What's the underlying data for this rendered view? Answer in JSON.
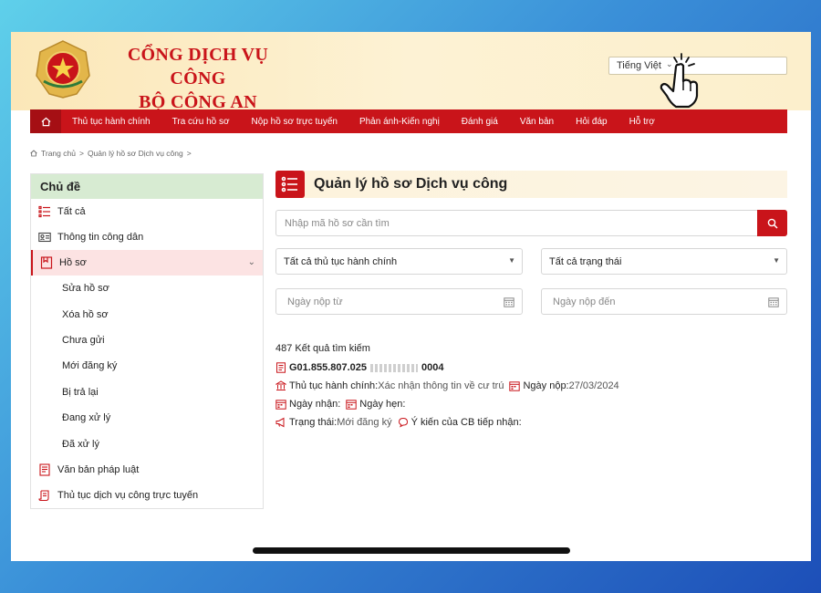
{
  "header": {
    "title_line1": "CỔNG DỊCH VỤ CÔNG",
    "title_line2": "BỘ CÔNG AN",
    "language": "Tiếng Việt"
  },
  "nav": {
    "items": [
      "Thủ tục hành chính",
      "Tra cứu hồ sơ",
      "Nộp hồ sơ trực tuyến",
      "Phản ánh-Kiến nghị",
      "Đánh giá",
      "Văn bản",
      "Hỏi đáp",
      "Hỗ trợ"
    ]
  },
  "breadcrumb": {
    "home": "Trang chủ",
    "current": "Quản lý hồ sơ Dịch vụ công",
    "sep": ">"
  },
  "sidebar": {
    "heading": "Chủ đề",
    "items": [
      {
        "label": "Tất cả",
        "icon": "list-icon"
      },
      {
        "label": "Thông tin công dân",
        "icon": "id-card-icon"
      },
      {
        "label": "Hồ sơ",
        "icon": "folder-icon"
      }
    ],
    "sub_items": [
      "Sửa hồ sơ",
      "Xóa hồ sơ",
      "Chưa gửi",
      "Mới đăng ký",
      "Bị trả lại",
      "Đang xử lý",
      "Đã xử lý"
    ],
    "bottom_items": [
      {
        "label": "Văn bản pháp luật",
        "icon": "document-icon"
      },
      {
        "label": "Thủ tục dịch vụ công trực tuyến",
        "icon": "scroll-icon"
      }
    ]
  },
  "main": {
    "title": "Quản lý hồ sơ Dịch vụ công",
    "search_placeholder": "Nhập mã hồ sơ cần tìm",
    "procedure_select": "Tất cả thủ tục hành chính",
    "status_select": "Tất cả trạng thái",
    "date_from_placeholder": "Ngày nộp từ",
    "date_to_placeholder": "Ngày nộp đến",
    "result_count": "487 Kết quả tìm kiếm"
  },
  "record": {
    "code_prefix": "G01.855.807.025",
    "code_suffix": "0004",
    "procedure_label": "Thủ tục hành chính:",
    "procedure_value": "Xác nhận thông tin về cư trú",
    "submit_label": "Ngày nộp:",
    "submit_value": "27/03/2024",
    "received_label": "Ngày nhận:",
    "appointment_label": "Ngày hẹn:",
    "status_label": "Trạng thái:",
    "status_value": "Mới đăng ký",
    "opinion_label": "Ý kiến của CB tiếp nhận:"
  },
  "colors": {
    "brand_red": "#c9141a",
    "header_gold": "#fbe7b8",
    "sidebar_head_green": "#d7ebd2"
  }
}
